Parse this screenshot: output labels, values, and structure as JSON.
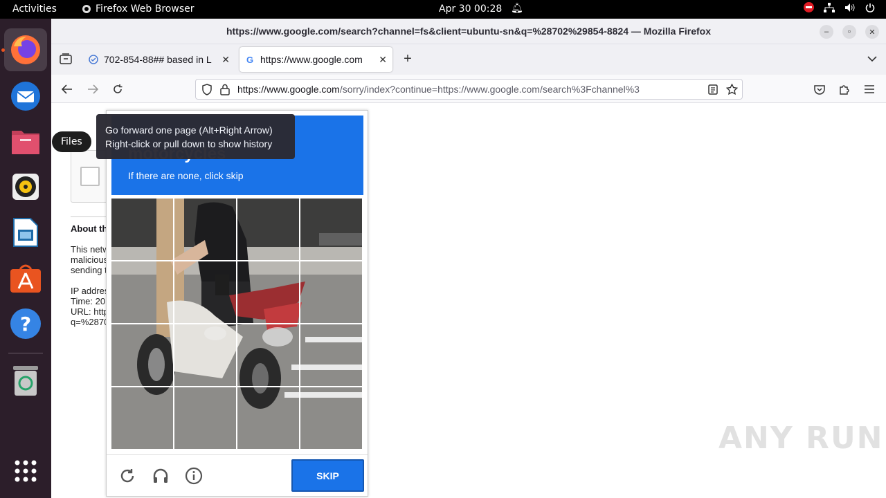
{
  "topbar": {
    "activities": "Activities",
    "app_name": "Firefox Web Browser",
    "clock": "Apr 30  00:28"
  },
  "dock": {
    "files_tooltip": "Files"
  },
  "window": {
    "title": "https://www.google.com/search?channel=fs&client=ubuntu-sn&q=%28702%29854-8824 — Mozilla Firefox"
  },
  "tabs": [
    {
      "label": "702-854-88## based in L"
    },
    {
      "label": "https://www.google.com"
    }
  ],
  "navbar": {
    "url_host": "https://www.google.com",
    "url_rest": "/sorry/index?continue=https://www.google.com/search%3Fchannel%3",
    "forward_tooltip_line1": "Go forward one page (Alt+Right Arrow)",
    "forward_tooltip_line2": "Right-click or pull down to show history"
  },
  "page": {
    "about_heading": "About th",
    "para1": [
      "This netw",
      "malicious",
      "sending t"
    ],
    "para2": [
      "IP addres",
      "Time: 20",
      "URL: http",
      "q=%2870"
    ]
  },
  "captcha": {
    "select_word": "motorcycles",
    "instruction": "If there are none, click skip",
    "skip_label": "SKIP"
  },
  "watermark": "ANY RUN",
  "colors": {
    "captcha_blue": "#1a73e8",
    "dock_bg": "#2c1e2a",
    "accent_orange": "#e95420"
  }
}
